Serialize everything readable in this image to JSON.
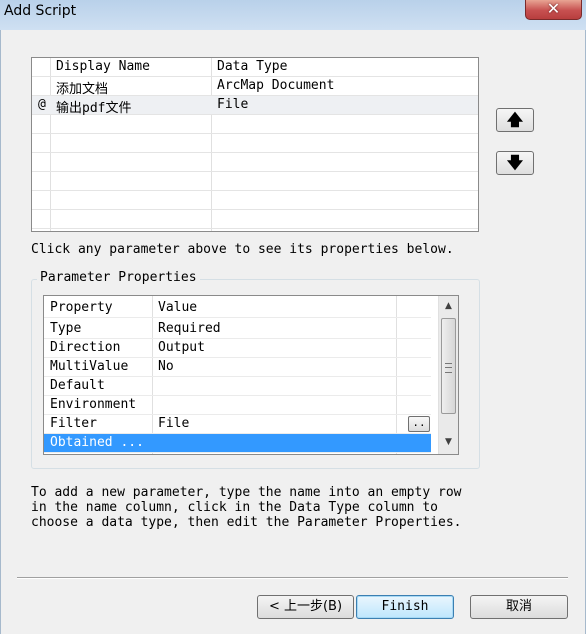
{
  "window": {
    "title": "Add Script",
    "close_label": "✕"
  },
  "param_table": {
    "columns": [
      "Display Name",
      "Data Type"
    ],
    "rows": [
      {
        "marker": "",
        "display_name": "添加文档",
        "data_type": "ArcMap Document"
      },
      {
        "marker": "@",
        "display_name": "输出pdf文件",
        "data_type": "File"
      }
    ]
  },
  "instructions": {
    "click_param": "Click any parameter above to see its properties below.",
    "add_param": "To add a new parameter, type the name into an empty row\nin the name column, click in the Data Type column to\nchoose a data type, then edit the Parameter Properties."
  },
  "param_properties": {
    "group_label": "Parameter Properties",
    "columns": [
      "Property",
      "Value"
    ],
    "rows": [
      {
        "property": "Type",
        "value": "Required"
      },
      {
        "property": "Direction",
        "value": "Output"
      },
      {
        "property": "MultiValue",
        "value": "No"
      },
      {
        "property": "Default",
        "value": ""
      },
      {
        "property": "Environment",
        "value": ""
      },
      {
        "property": "Filter",
        "value": "File"
      },
      {
        "property": "Obtained ...",
        "value": ""
      }
    ],
    "browse_label": ".."
  },
  "buttons": {
    "move_up": "🡅",
    "move_down": "🡇",
    "back": "< 上一步(B)",
    "finish": "Finish",
    "cancel": "取消"
  },
  "colors": {
    "selection": "#3399ff",
    "finish_border": "#3c7fb1"
  }
}
